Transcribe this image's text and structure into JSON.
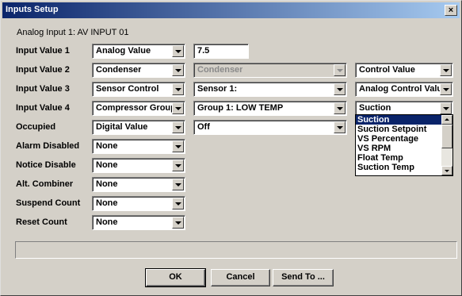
{
  "window": {
    "title": "Inputs Setup",
    "close_glyph": "×"
  },
  "subtitle": "Analog Input 1: AV INPUT 01",
  "rows": [
    {
      "label": "Input Value 1",
      "type": "Analog Value",
      "value": "7.5"
    },
    {
      "label": "Input Value 2",
      "type": "Condenser",
      "source": "Condenser",
      "property": "Control Value"
    },
    {
      "label": "Input Value 3",
      "type": "Sensor Control",
      "source": "Sensor 1:",
      "property": "Analog Control Valu"
    },
    {
      "label": "Input Value 4",
      "type": "Compressor Group",
      "source": "Group 1: LOW TEMP",
      "property": "Suction"
    },
    {
      "label": "Occupied",
      "type": "Digital Value",
      "source": "Off"
    },
    {
      "label": "Alarm Disabled",
      "type": "None"
    },
    {
      "label": "Notice Disable",
      "type": "None"
    },
    {
      "label": "Alt. Combiner",
      "type": "None"
    },
    {
      "label": "Suspend Count",
      "type": "None"
    },
    {
      "label": "Reset Count",
      "type": "None"
    }
  ],
  "dropdown_options": [
    "Suction",
    "Suction Setpoint",
    "VS Percentage",
    "VS RPM",
    "Float Temp",
    "Suction Temp"
  ],
  "buttons": {
    "ok": "OK",
    "cancel": "Cancel",
    "send_to": "Send To ..."
  }
}
